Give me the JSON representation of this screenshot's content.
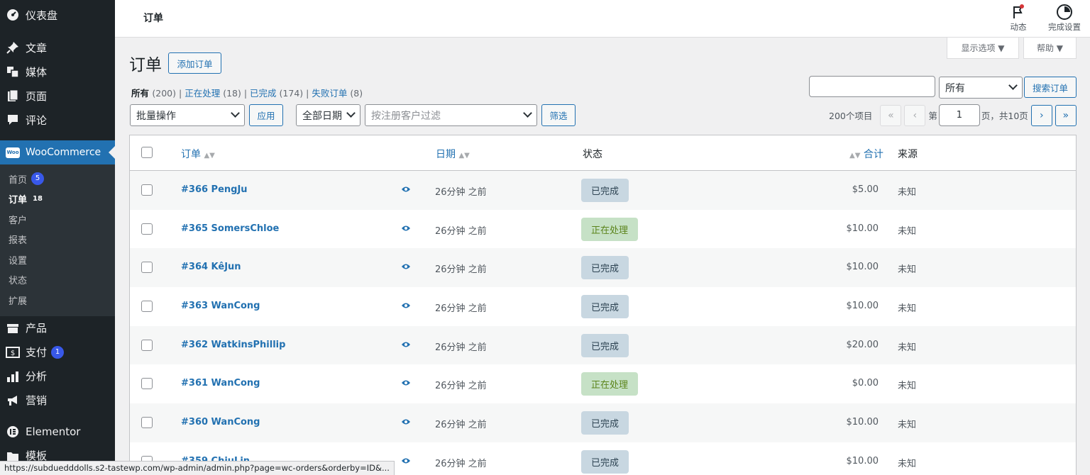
{
  "sidebar": {
    "top_items": [
      {
        "label": "仪表盘",
        "icon": "dashboard-icon"
      },
      {
        "label": "文章",
        "icon": "pin-icon"
      },
      {
        "label": "媒体",
        "icon": "media-icon"
      },
      {
        "label": "页面",
        "icon": "page-icon"
      },
      {
        "label": "评论",
        "icon": "comment-icon"
      }
    ],
    "woocommerce": {
      "label": "WooCommerce",
      "logo_text": "Woo"
    },
    "sub_items": [
      {
        "label": "首页",
        "badge": "5"
      },
      {
        "label": "订单",
        "badge": "18"
      },
      {
        "label": "客户"
      },
      {
        "label": "报表"
      },
      {
        "label": "设置"
      },
      {
        "label": "状态"
      },
      {
        "label": "扩展"
      }
    ],
    "bottom_items": [
      {
        "label": "产品",
        "icon": "product-icon"
      },
      {
        "label": "支付",
        "icon": "payment-icon",
        "badge": "1"
      },
      {
        "label": "分析",
        "icon": "analytics-icon"
      },
      {
        "label": "营销",
        "icon": "megaphone-icon"
      },
      {
        "label": "Elementor",
        "icon": "elementor-icon"
      },
      {
        "label": "模板",
        "icon": "folder-icon"
      }
    ]
  },
  "header": {
    "title": "订单",
    "activity_label": "动态",
    "setup_label": "完成设置"
  },
  "screen_options": {
    "label": "显示选项 ▼",
    "help": "帮助 ▼"
  },
  "page": {
    "heading": "订单",
    "add_order": "添加订单"
  },
  "views": {
    "all": "所有",
    "all_count": "(200)",
    "processing": "正在处理",
    "processing_count": "(18)",
    "completed": "已完成",
    "completed_count": "(174)",
    "failed": "失败订单",
    "failed_count": "(8)",
    "sep": "|"
  },
  "filters": {
    "bulk_action": "批量操作",
    "apply": "应用",
    "all_dates": "全部日期",
    "customer_placeholder": "按注册客户过滤",
    "filter": "筛选"
  },
  "search": {
    "status_select": "所有",
    "button": "搜索订单",
    "value": ""
  },
  "pagination": {
    "items": "200个项目",
    "first": "«",
    "prev": "‹",
    "next": "›",
    "last": "»",
    "page_prefix": "第",
    "current_page": "1",
    "page_suffix": "页，共10页"
  },
  "table": {
    "headers": {
      "order": "订单",
      "date": "日期",
      "status": "状态",
      "total": "合计",
      "origin": "来源"
    },
    "rows": [
      {
        "order": "#366 PengJu",
        "date": "26分钟 之前",
        "status": "已完成",
        "status_type": "done",
        "total": "$5.00",
        "origin": "未知"
      },
      {
        "order": "#365 SomersChloe",
        "date": "26分钟 之前",
        "status": "正在处理",
        "status_type": "proc",
        "total": "$10.00",
        "origin": "未知"
      },
      {
        "order": "#364 KêJun",
        "date": "26分钟 之前",
        "status": "已完成",
        "status_type": "done",
        "total": "$10.00",
        "origin": "未知"
      },
      {
        "order": "#363 WanCong",
        "date": "26分钟 之前",
        "status": "已完成",
        "status_type": "done",
        "total": "$10.00",
        "origin": "未知"
      },
      {
        "order": "#362 WatkinsPhillip",
        "date": "26分钟 之前",
        "status": "已完成",
        "status_type": "done",
        "total": "$20.00",
        "origin": "未知"
      },
      {
        "order": "#361 WanCong",
        "date": "26分钟 之前",
        "status": "正在处理",
        "status_type": "proc",
        "total": "$0.00",
        "origin": "未知"
      },
      {
        "order": "#360 WanCong",
        "date": "26分钟 之前",
        "status": "已完成",
        "status_type": "done",
        "total": "$10.00",
        "origin": "未知"
      },
      {
        "order": "#359 ChiuLin",
        "date": "26分钟 之前",
        "status": "已完成",
        "status_type": "done",
        "total": "$10.00",
        "origin": "未知"
      }
    ]
  },
  "statusbar": {
    "url": "https://subduedddolls.s2-tastewp.com/wp-admin/admin.php?page=wc-orders&orderby=ID&..."
  },
  "colors": {
    "accent": "#2271b1",
    "sidebar_bg": "#1d2327",
    "badge": "#3858e9",
    "completed_bg": "#c8d7e1",
    "processing_bg": "#c6e1c6"
  }
}
